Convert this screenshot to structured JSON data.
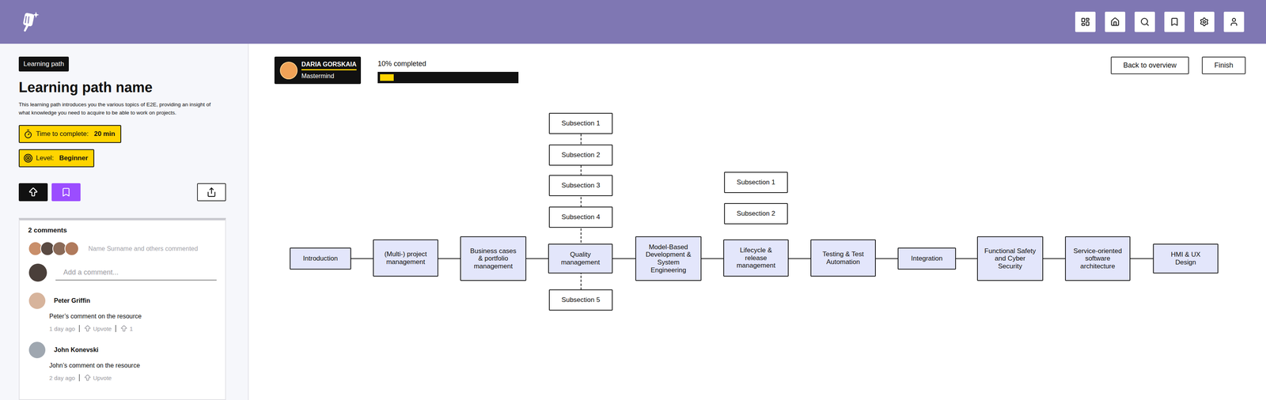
{
  "learning_path": {
    "badge": "Learning path",
    "title": "Learning path name",
    "description": "This learning path introduces you the various topics of E2E, providing an insight of what knowledge you need to acquire to be able to work on projects.",
    "time": {
      "label": "Time to complete:",
      "value": "20 min"
    },
    "level": {
      "label": "Level:",
      "value": "Beginner"
    }
  },
  "comments": {
    "count_label": "2 comments",
    "summary": "Name Surname and others commented",
    "input_placeholder": "Add a comment...",
    "items": [
      {
        "author": "Peter Griffin",
        "text": "Peter’s comment on the resource",
        "time": "1 day ago",
        "upvote_label": "Upvote",
        "upvotes": "1"
      },
      {
        "author": "John Konevski",
        "text": "John’s comment on the resource",
        "time": "2 day ago",
        "upvote_label": "Upvote",
        "upvotes": null
      }
    ]
  },
  "user": {
    "name": "DARIA GORSKAIA",
    "role": "Mastermind"
  },
  "progress": {
    "label": "10% completed",
    "level": 0.1
  },
  "buttons": [
    "Back to overview",
    "Finish"
  ],
  "diagram": {
    "nodes": [
      {
        "label": "Introduction",
        "connected": false,
        "subsections": []
      },
      {
        "label": "(Multi-) project management",
        "connected": false,
        "subsections": []
      },
      {
        "label": "Business cases & portfolio management",
        "connected": false,
        "subsections": []
      },
      {
        "label": "Quality management",
        "connected": true,
        "subsections": [
          "Subsection 1",
          "Subsection 2",
          "Subsection 3",
          "Subsection 4",
          "Subsection 5"
        ]
      },
      {
        "label": "Model-Based Development & System Engineering",
        "connected": false,
        "subsections": []
      },
      {
        "label": "Lifecycle & release management",
        "connected": false,
        "subsections": [
          "Subsection 1",
          "Subsection 2"
        ]
      },
      {
        "label": "Testing & Test Automation",
        "connected": false,
        "subsections": []
      },
      {
        "label": "Integration",
        "connected": false,
        "subsections": []
      },
      {
        "label": "Functional Safety and Cyber Security",
        "connected": false,
        "subsections": []
      },
      {
        "label": "Service-oriented software architecture",
        "connected": false,
        "subsections": []
      },
      {
        "label": "HMI & UX Design",
        "connected": false,
        "subsections": []
      }
    ]
  }
}
